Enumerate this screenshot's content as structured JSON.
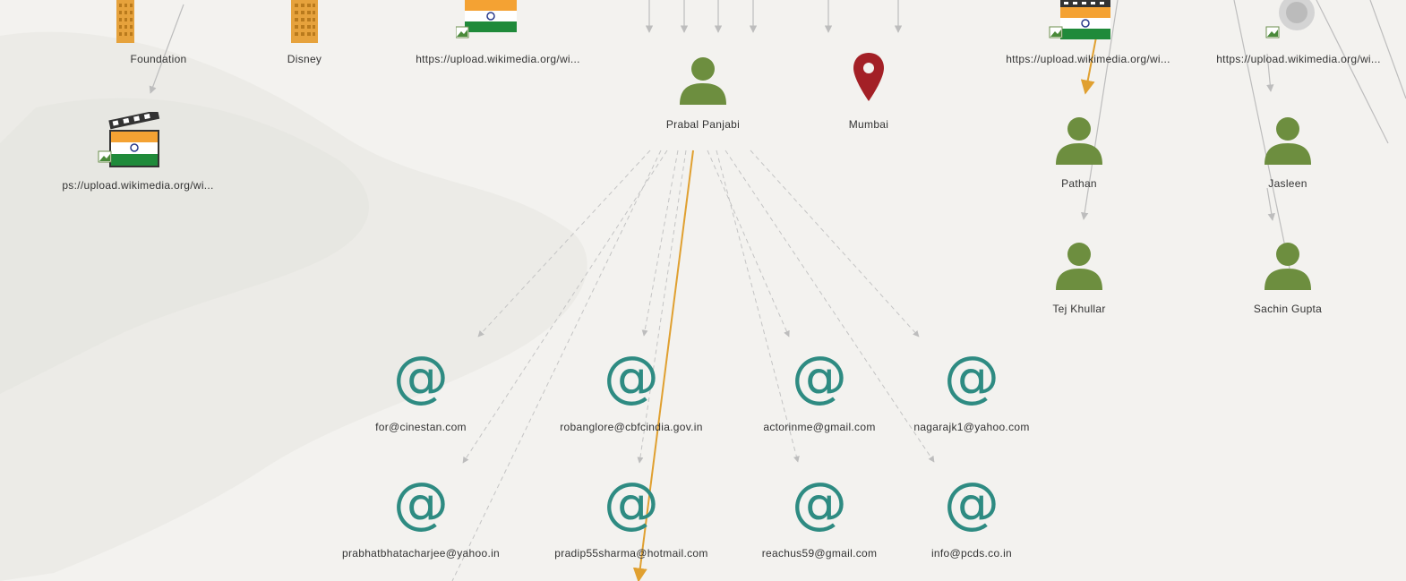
{
  "colors": {
    "background": "#f3f2ef",
    "person": "#6d8e3f",
    "email": "#2e8b82",
    "location_pin": "#a32026",
    "edge_highlight": "#e0a030",
    "edge_default": "#b8b8b8"
  },
  "nodes": {
    "foundation": {
      "label": "Foundation",
      "icon": "building-icon"
    },
    "disney": {
      "label": "Disney",
      "icon": "building-icon"
    },
    "wiki_top_left": {
      "label": "https://upload.wikimedia.org/wi...",
      "icon": "india-flag-icon"
    },
    "prabal": {
      "label": "Prabal Panjabi",
      "icon": "person-icon"
    },
    "mumbai": {
      "label": "Mumbai",
      "icon": "location-pin-icon"
    },
    "wiki_top_right_1": {
      "label": "https://upload.wikimedia.org/wi...",
      "icon": "film-flag-icon"
    },
    "wiki_top_right_2": {
      "label": "https://upload.wikimedia.org/wi...",
      "icon": "image-icon"
    },
    "wiki_left": {
      "label": "ps://upload.wikimedia.org/wi...",
      "icon": "film-flag-icon"
    },
    "pathan": {
      "label": "Pathan",
      "icon": "person-icon"
    },
    "jasleen": {
      "label": "Jasleen",
      "icon": "person-icon"
    },
    "tej": {
      "label": "Tej Khullar",
      "icon": "person-icon"
    },
    "sachin": {
      "label": "Sachin Gupta",
      "icon": "person-icon"
    }
  },
  "emails": [
    {
      "label": "for@cinestan.com",
      "icon": "at-icon"
    },
    {
      "label": "robanglore@cbfcindia.gov.in",
      "icon": "at-icon"
    },
    {
      "label": "actorinme@gmail.com",
      "icon": "at-icon"
    },
    {
      "label": "nagarajk1@yahoo.com",
      "icon": "at-icon"
    },
    {
      "label": "prabhatbhatacharjee@yahoo.in",
      "icon": "at-icon"
    },
    {
      "label": "pradip55sharma@hotmail.com",
      "icon": "at-icon"
    },
    {
      "label": "reachus59@gmail.com",
      "icon": "at-icon"
    },
    {
      "label": "info@pcds.co.in",
      "icon": "at-icon"
    }
  ],
  "at_symbol": "@"
}
